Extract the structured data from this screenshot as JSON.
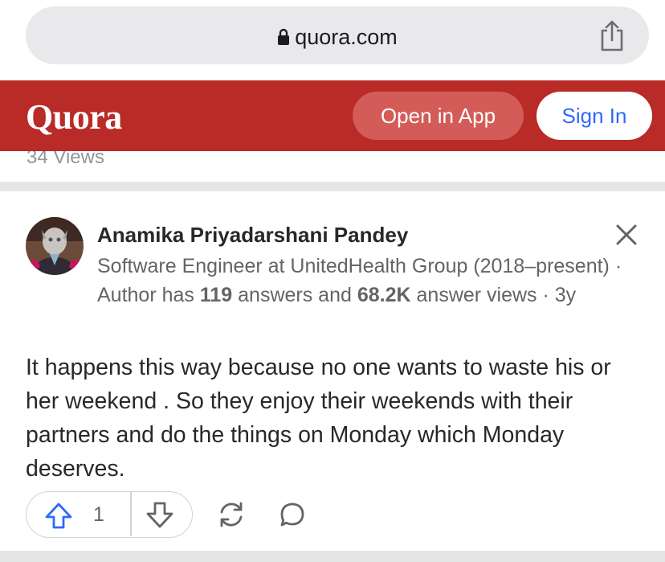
{
  "browser": {
    "url": "quora.com",
    "icons": {
      "lock": "lock-icon",
      "share": "share-icon"
    }
  },
  "header": {
    "logo": "Quora",
    "open_in_app_label": "Open in App",
    "sign_in_label": "Sign In",
    "brand_color": "#b92b27",
    "accent_color": "#2e69ff"
  },
  "previous_item": {
    "views": "34 Views"
  },
  "answer": {
    "author_name": "Anamika Priyadarshani Pandey",
    "credential": {
      "line_start": "Software Engineer at UnitedHealth Group (2018–present) · Author has ",
      "answers_count": "119",
      "middle": " answers and ",
      "views_count": "68.2K",
      "line_end": " answer views · 3y"
    },
    "body": "It happens this way because no one wants to waste his or her weekend . So they enjoy their weekends with their partners and do the things on Monday which Monday deserves.",
    "upvotes": "1",
    "icons": {
      "upvote": "upvote-arrow-icon",
      "downvote": "downvote-arrow-icon",
      "share": "reshare-icon",
      "comment": "comment-icon",
      "close": "close-icon"
    }
  }
}
